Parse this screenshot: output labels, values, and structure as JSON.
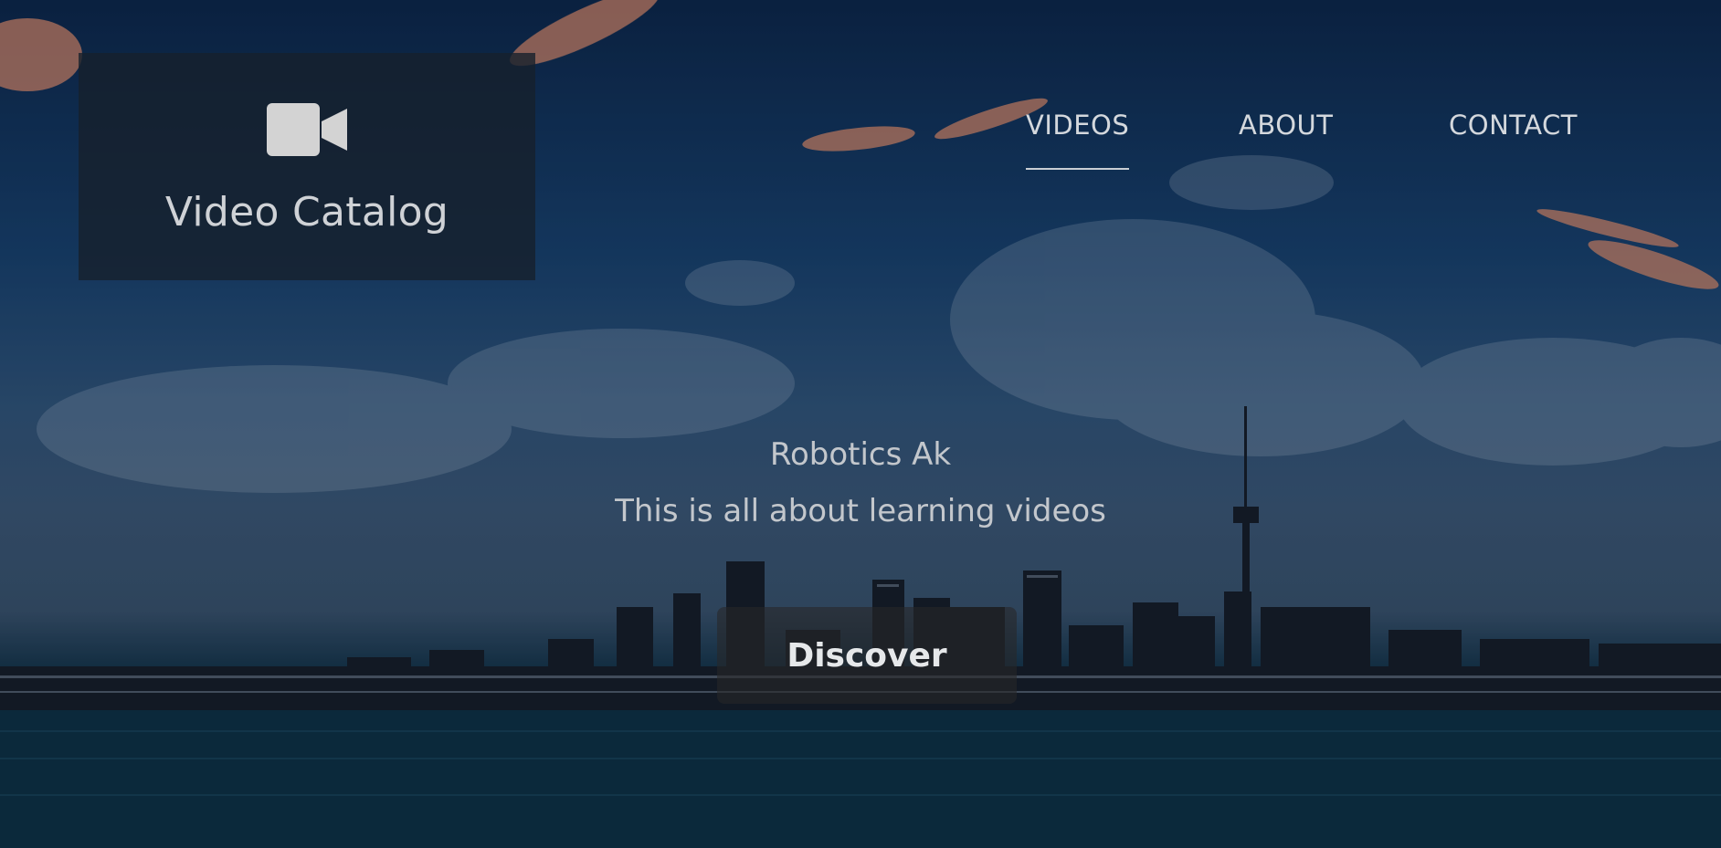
{
  "brand": {
    "title": "Video Catalog",
    "icon": "video-camera-icon"
  },
  "nav": {
    "items": [
      {
        "label": "VIDEOS",
        "active": true
      },
      {
        "label": "ABOUT",
        "active": false
      },
      {
        "label": "CONTACT",
        "active": false
      }
    ]
  },
  "hero": {
    "site_name": "Robotics Ak",
    "tagline": "This is all about learning videos",
    "cta_label": "Discover"
  },
  "colors": {
    "logo_box": "#16202c",
    "nav_text": "#d4d8dd",
    "sky_top": "#0c2648",
    "water": "#0b2a3a"
  }
}
